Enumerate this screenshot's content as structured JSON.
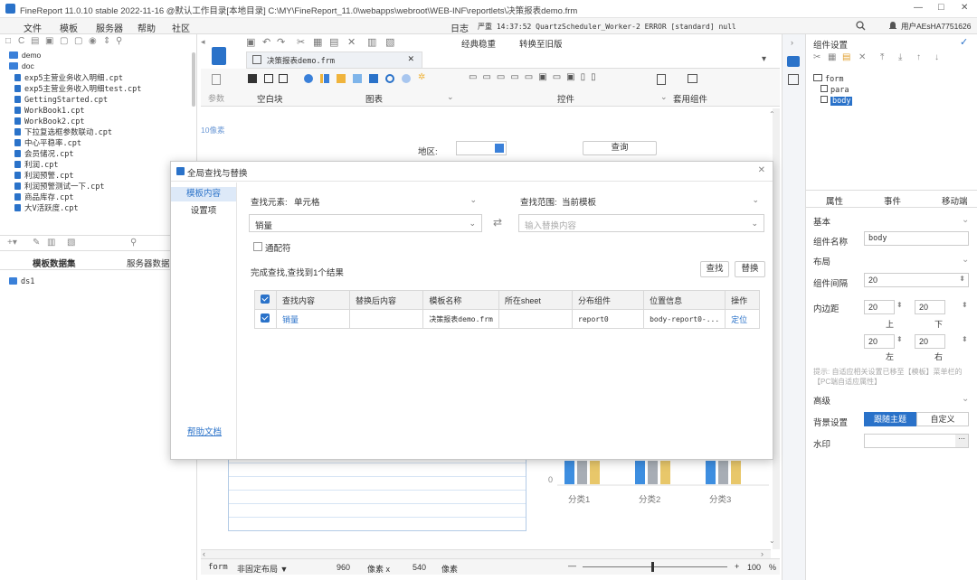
{
  "window": {
    "title": "FineReport 11.0.10 stable 2022-11-16 @默认工作目录[本地目录]   C:\\MY\\FineReport_11.0\\webapps\\webroot\\WEB-INF\\reportlets\\决策报表demo.frm",
    "controls": [
      "—",
      "□",
      "✕"
    ]
  },
  "menu": {
    "items": [
      "文件",
      "模板",
      "服务器",
      "帮助",
      "社区"
    ],
    "log_label": "日志",
    "log_text": "严重 14:37:52 QuartzScheduler_Worker-2 ERROR [standard] null",
    "user": "用户AEsHA7751626"
  },
  "left": {
    "tree": [
      {
        "name": "demo",
        "type": "folder"
      },
      {
        "name": "doc",
        "type": "folder"
      },
      {
        "name": "exp5主营业务收入明细.cpt",
        "type": "file"
      },
      {
        "name": "exp5主营业务收入明细test.cpt",
        "type": "file"
      },
      {
        "name": "GettingStarted.cpt",
        "type": "file"
      },
      {
        "name": "WorkBook1.cpt",
        "type": "file"
      },
      {
        "name": "WorkBook2.cpt",
        "type": "file"
      },
      {
        "name": "下拉复选框参数联动.cpt",
        "type": "file"
      },
      {
        "name": "中心平稳率.cpt",
        "type": "file"
      },
      {
        "name": "会员储况.cpt",
        "type": "file"
      },
      {
        "name": "利润.cpt",
        "type": "file"
      },
      {
        "name": "利润预警.cpt",
        "type": "file"
      },
      {
        "name": "利润预警测试一下.cpt",
        "type": "file"
      },
      {
        "name": "商品库存.cpt",
        "type": "file"
      },
      {
        "name": "大V活跃度.cpt",
        "type": "file"
      }
    ],
    "dataset_tabs": [
      "模板数据集",
      "服务器数据集"
    ],
    "dataset_item": "ds1"
  },
  "center": {
    "tab_label": "决策报表demo.frm",
    "classic_tab": "经典稳重",
    "switch_old": "转换至旧版",
    "toolbar_groups": [
      "空白块",
      "图表",
      "控件",
      "套用组件"
    ],
    "params_label": "参数",
    "pixel_hint": "10像素",
    "region_label": "地区:",
    "query_button": "查询",
    "categories": [
      "分类1",
      "分类2",
      "分类3"
    ],
    "zero_label": "0",
    "status": {
      "form": "form",
      "layout": "非固定布局 ▼",
      "width": "960",
      "width_unit": "像素 x",
      "height": "540",
      "height_unit": "像素",
      "zoom": "100",
      "zoom_unit": "%"
    }
  },
  "dialog": {
    "title": "全局查找与替换",
    "side_tabs": [
      "模板内容",
      "设置项"
    ],
    "help_link": "帮助文档",
    "find_element_label": "查找元素:",
    "find_element_value": "单元格",
    "find_scope_label": "查找范围:",
    "find_scope_value": "当前模板",
    "search_text": "销量",
    "replace_placeholder": "输入替换内容",
    "wildcard_label": "通配符",
    "result_text": "完成查找,查找到1个结果",
    "find_button": "查找",
    "replace_button": "替换",
    "table": {
      "headers": [
        "查找内容",
        "替换后内容",
        "模板名称",
        "所在sheet",
        "分布组件",
        "位置信息",
        "操作"
      ],
      "rows": [
        {
          "content": "销量",
          "replaced": "",
          "template": "决策报表demo.frm",
          "sheet": "",
          "component": "report0",
          "position": "body-report0-...",
          "action": "定位"
        }
      ]
    }
  },
  "right": {
    "title": "组件设置",
    "tree": [
      "form",
      "para",
      "body"
    ],
    "tabs": [
      "属性",
      "事件",
      "移动端"
    ],
    "section_basic": "基本",
    "name_label": "组件名称",
    "name_value": "body",
    "section_layout": "布局",
    "gap_label": "组件间隔",
    "gap_value": "20",
    "padding_label": "内边距",
    "padding": {
      "top": "20",
      "bottom": "20",
      "left": "20",
      "right": "20"
    },
    "side_labels": {
      "top": "上",
      "bottom": "下",
      "left": "左",
      "right": "右"
    },
    "hint": "提示: 自适应相关设置已移至【模板】菜单栏的【PC端自适应属性】",
    "section_advanced": "高级",
    "bg_label": "背景设置",
    "bg_follow": "跟随主题",
    "bg_custom": "自定义",
    "watermark_label": "水印"
  },
  "colors": {
    "accent": "#2a72c9",
    "bar_blue": "#3d8ee0",
    "bar_yellow": "#e8c76a",
    "bar_gray": "#a7adb5"
  }
}
